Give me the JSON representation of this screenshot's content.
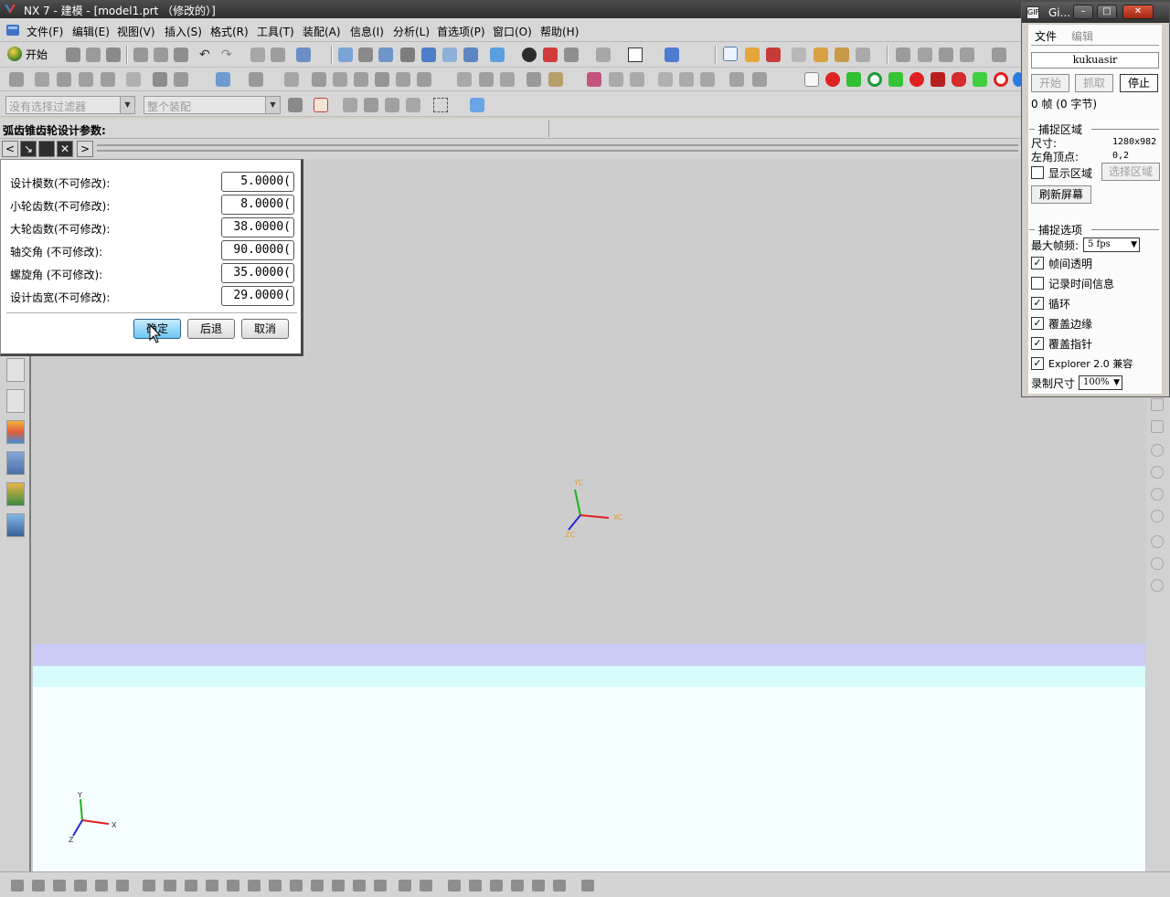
{
  "window": {
    "title": "NX 7 - 建模 - [model1.prt （修改的）]"
  },
  "menu": {
    "items": [
      "文件(F)",
      "编辑(E)",
      "视图(V)",
      "插入(S)",
      "格式(R)",
      "工具(T)",
      "装配(A)",
      "信息(I)",
      "分析(L)",
      "首选项(P)",
      "窗口(O)",
      "帮助(H)"
    ]
  },
  "toolbar": {
    "start_label": "开始"
  },
  "selection": {
    "filter_placeholder": "没有选择过滤器",
    "scope_placeholder": "整个装配"
  },
  "cue_line": {
    "text": "弧齿锥齿轮设计参数:"
  },
  "dialog": {
    "params": [
      {
        "label": "设计模数(不可修改):",
        "value": "5.0000("
      },
      {
        "label": "小轮齿数(不可修改):",
        "value": "8.0000("
      },
      {
        "label": "大轮齿数(不可修改):",
        "value": "38.0000("
      },
      {
        "label": "轴交角 (不可修改):",
        "value": "90.0000("
      },
      {
        "label": "螺旋角 (不可修改):",
        "value": "35.0000("
      },
      {
        "label": "设计齿宽(不可修改):",
        "value": "29.0000("
      }
    ],
    "ok_label": "确定",
    "back_label": "后退",
    "cancel_label": "取消"
  },
  "triad": {
    "xc": "XC",
    "yc": "YC",
    "zc": "ZC"
  },
  "abs_triad": {
    "x": "X",
    "y": "Y",
    "z": "Z"
  },
  "capture": {
    "title": "Gi...",
    "menu_file": "文件",
    "menu_edit": "编辑",
    "name": "kukuasir",
    "btn_start": "开始",
    "btn_grab": "抓取",
    "btn_stop": "停止",
    "frames": "0 帧 (0 字节)",
    "area_group": "捕捉区域",
    "size_label": "尺寸:",
    "size_value": "1280x982",
    "corner_label": "左角顶点:",
    "corner_value": "0,2",
    "show_area": "显示区域",
    "select_area": "选择区域",
    "refresh": "刷新屏幕",
    "options_group": "捕捉选项",
    "max_fps_label": "最大帧频:",
    "max_fps_value": "5 fps",
    "opt_transparent": "帧间透明",
    "opt_record_time": "记录时间信息",
    "opt_loop": "循环",
    "opt_cover_edge": "覆盖边缘",
    "opt_cover_pointer": "覆盖指针",
    "opt_explorer": "Explorer 2.0 兼容",
    "rec_size_label": "录制尺寸",
    "rec_size_value": "100%",
    "checks": {
      "show_area": false,
      "transparent": true,
      "record_time": false,
      "loop": true,
      "cover_edge": true,
      "cover_pointer": true,
      "explorer": true
    }
  },
  "colors": {
    "graphics_bg": "#cdcdcd",
    "band_lavender": "#cbcbf6",
    "band_cyan": "#d5fbfa",
    "ok_button": "#6cc6f4"
  }
}
